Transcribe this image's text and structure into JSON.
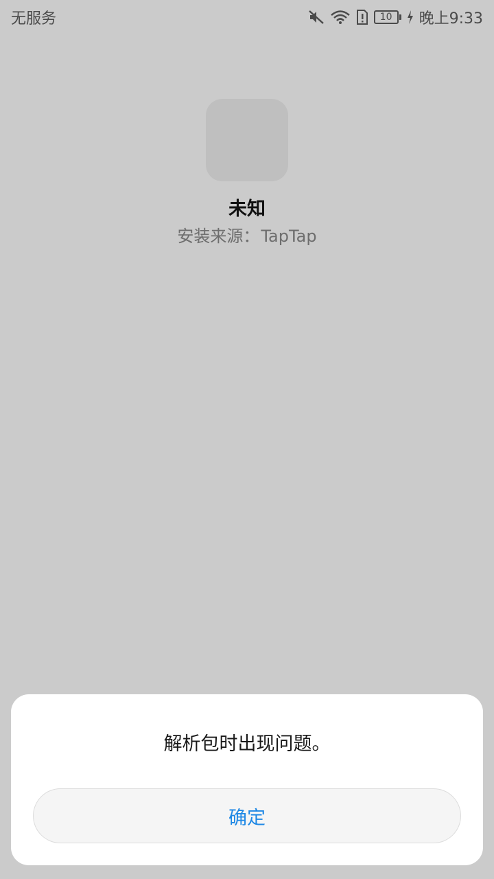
{
  "status_bar": {
    "carrier": "无服务",
    "battery_level": "10",
    "time": "晚上9:33",
    "icons": [
      "mute-icon",
      "wifi-icon",
      "sim-alert-icon",
      "battery-icon",
      "charging-icon"
    ]
  },
  "app": {
    "name": "未知",
    "source_label": "安装来源：",
    "source_value": "TapTap"
  },
  "dialog": {
    "message": "解析包时出现问题。",
    "confirm_label": "确定"
  },
  "colors": {
    "background": "#cbcbcb",
    "accent": "#1e88e5",
    "dialog_bg": "#ffffff"
  }
}
